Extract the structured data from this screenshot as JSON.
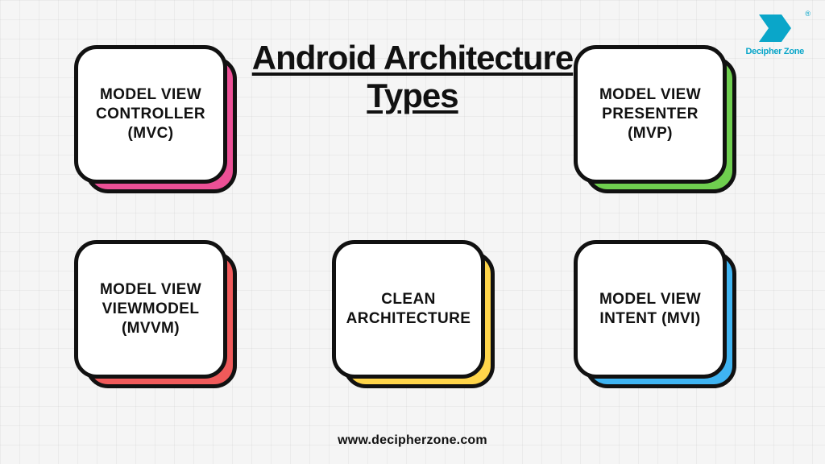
{
  "title": "Android\nArchitecture\nTypes",
  "brand": {
    "name": "Decipher Zone",
    "mark": "®"
  },
  "footer": "www.decipherzone.com",
  "cards": [
    {
      "label": "MODEL VIEW\nCONTROLLER\n(MVC)",
      "accent": "#ec5096"
    },
    {
      "label": "MODEL VIEW\nPRESENTER\n(MVP)",
      "accent": "#6fcf4f"
    },
    {
      "label": "MODEL VIEW\nVIEWMODEL\n(MVVM)",
      "accent": "#f05a5a"
    },
    {
      "label": "CLEAN\nARCHITECTURE",
      "accent": "#ffd54a"
    },
    {
      "label": "MODEL VIEW\nINTENT (MVI)",
      "accent": "#3fb4f2"
    }
  ],
  "chart_data": {
    "type": "table",
    "title": "Android Architecture Types",
    "items": [
      "Model View Controller (MVC)",
      "Model View Presenter (MVP)",
      "Model View ViewModel (MVVM)",
      "Clean Architecture",
      "Model View Intent (MVI)"
    ]
  }
}
